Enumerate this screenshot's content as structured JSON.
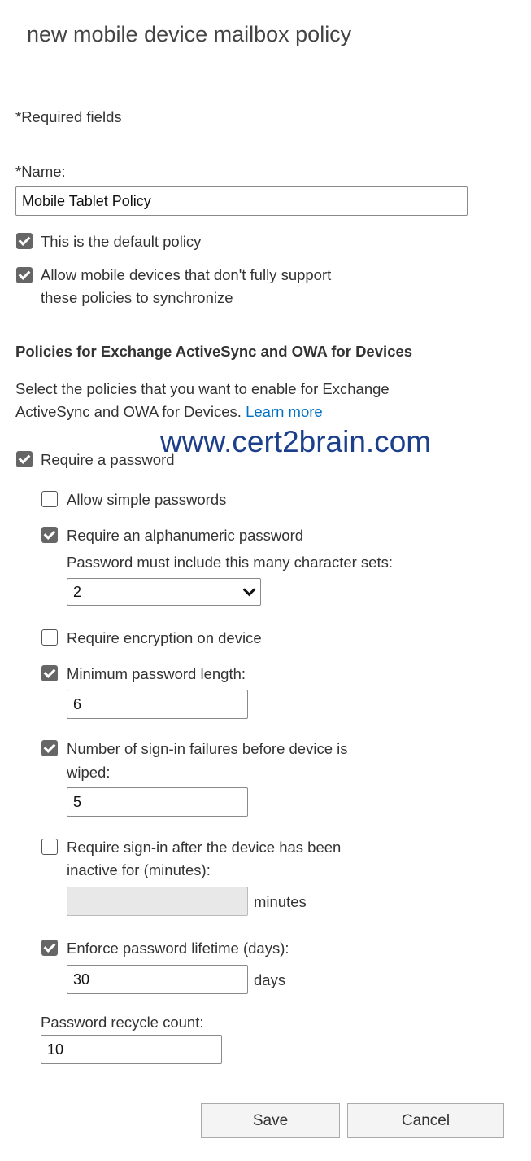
{
  "title": "new mobile device mailbox policy",
  "required_note": "*Required fields",
  "name": {
    "label": "*Name:",
    "value": "Mobile Tablet Policy"
  },
  "default_policy": {
    "label": "This is the default policy",
    "checked": true
  },
  "allow_nonsupport": {
    "line1": "Allow mobile devices that don't fully support",
    "line2": "these policies to synchronize",
    "checked": true
  },
  "section": {
    "heading": "Policies for Exchange ActiveSync and OWA for Devices",
    "desc1": "Select the policies that you want to enable for Exchange",
    "desc2": "ActiveSync and OWA for Devices.",
    "learn_more": "Learn more"
  },
  "watermark": "www.cert2brain.com",
  "require_password": {
    "label": "Require a password",
    "checked": true
  },
  "allow_simple": {
    "label": "Allow simple passwords",
    "checked": false
  },
  "alphanumeric": {
    "label": "Require an alphanumeric password",
    "checked": true,
    "sets_label": "Password must include this many character sets:",
    "sets_value": "2"
  },
  "encryption": {
    "label": "Require encryption on device",
    "checked": false
  },
  "min_length": {
    "label": "Minimum password length:",
    "checked": true,
    "value": "6"
  },
  "failures": {
    "line1": "Number of sign-in failures before device is",
    "line2": "wiped:",
    "checked": true,
    "value": "5"
  },
  "inactive": {
    "line1": "Require sign-in after the device has been",
    "line2": "inactive for (minutes):",
    "checked": false,
    "value": "",
    "unit": "minutes"
  },
  "lifetime": {
    "label": "Enforce password lifetime (days):",
    "checked": true,
    "value": "30",
    "unit": "days"
  },
  "recycle": {
    "label": "Password recycle count:",
    "value": "10"
  },
  "buttons": {
    "save": "Save",
    "cancel": "Cancel"
  }
}
